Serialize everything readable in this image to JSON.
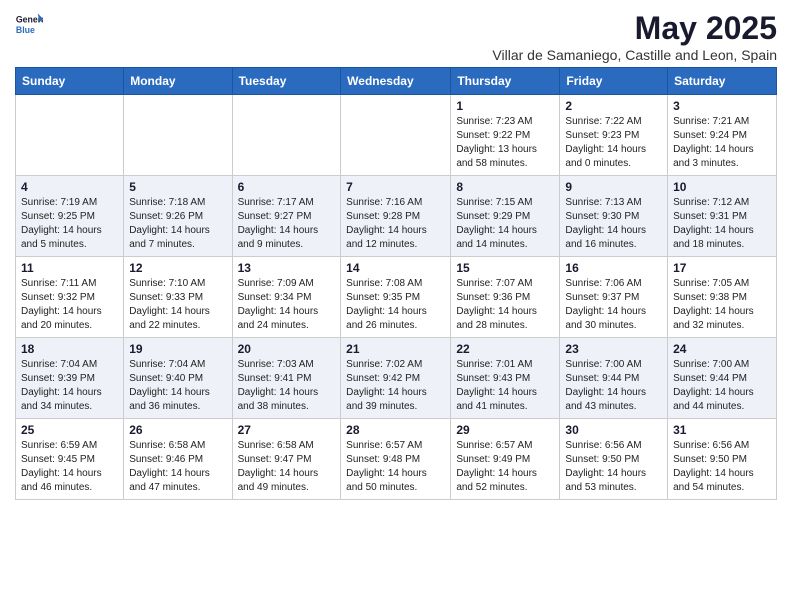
{
  "header": {
    "logo_general": "General",
    "logo_blue": "Blue",
    "title": "May 2025",
    "subtitle": "Villar de Samaniego, Castille and Leon, Spain"
  },
  "weekdays": [
    "Sunday",
    "Monday",
    "Tuesday",
    "Wednesday",
    "Thursday",
    "Friday",
    "Saturday"
  ],
  "weeks": [
    [
      {
        "day": "",
        "info": ""
      },
      {
        "day": "",
        "info": ""
      },
      {
        "day": "",
        "info": ""
      },
      {
        "day": "",
        "info": ""
      },
      {
        "day": "1",
        "info": "Sunrise: 7:23 AM\nSunset: 9:22 PM\nDaylight: 13 hours\nand 58 minutes."
      },
      {
        "day": "2",
        "info": "Sunrise: 7:22 AM\nSunset: 9:23 PM\nDaylight: 14 hours\nand 0 minutes."
      },
      {
        "day": "3",
        "info": "Sunrise: 7:21 AM\nSunset: 9:24 PM\nDaylight: 14 hours\nand 3 minutes."
      }
    ],
    [
      {
        "day": "4",
        "info": "Sunrise: 7:19 AM\nSunset: 9:25 PM\nDaylight: 14 hours\nand 5 minutes."
      },
      {
        "day": "5",
        "info": "Sunrise: 7:18 AM\nSunset: 9:26 PM\nDaylight: 14 hours\nand 7 minutes."
      },
      {
        "day": "6",
        "info": "Sunrise: 7:17 AM\nSunset: 9:27 PM\nDaylight: 14 hours\nand 9 minutes."
      },
      {
        "day": "7",
        "info": "Sunrise: 7:16 AM\nSunset: 9:28 PM\nDaylight: 14 hours\nand 12 minutes."
      },
      {
        "day": "8",
        "info": "Sunrise: 7:15 AM\nSunset: 9:29 PM\nDaylight: 14 hours\nand 14 minutes."
      },
      {
        "day": "9",
        "info": "Sunrise: 7:13 AM\nSunset: 9:30 PM\nDaylight: 14 hours\nand 16 minutes."
      },
      {
        "day": "10",
        "info": "Sunrise: 7:12 AM\nSunset: 9:31 PM\nDaylight: 14 hours\nand 18 minutes."
      }
    ],
    [
      {
        "day": "11",
        "info": "Sunrise: 7:11 AM\nSunset: 9:32 PM\nDaylight: 14 hours\nand 20 minutes."
      },
      {
        "day": "12",
        "info": "Sunrise: 7:10 AM\nSunset: 9:33 PM\nDaylight: 14 hours\nand 22 minutes."
      },
      {
        "day": "13",
        "info": "Sunrise: 7:09 AM\nSunset: 9:34 PM\nDaylight: 14 hours\nand 24 minutes."
      },
      {
        "day": "14",
        "info": "Sunrise: 7:08 AM\nSunset: 9:35 PM\nDaylight: 14 hours\nand 26 minutes."
      },
      {
        "day": "15",
        "info": "Sunrise: 7:07 AM\nSunset: 9:36 PM\nDaylight: 14 hours\nand 28 minutes."
      },
      {
        "day": "16",
        "info": "Sunrise: 7:06 AM\nSunset: 9:37 PM\nDaylight: 14 hours\nand 30 minutes."
      },
      {
        "day": "17",
        "info": "Sunrise: 7:05 AM\nSunset: 9:38 PM\nDaylight: 14 hours\nand 32 minutes."
      }
    ],
    [
      {
        "day": "18",
        "info": "Sunrise: 7:04 AM\nSunset: 9:39 PM\nDaylight: 14 hours\nand 34 minutes."
      },
      {
        "day": "19",
        "info": "Sunrise: 7:04 AM\nSunset: 9:40 PM\nDaylight: 14 hours\nand 36 minutes."
      },
      {
        "day": "20",
        "info": "Sunrise: 7:03 AM\nSunset: 9:41 PM\nDaylight: 14 hours\nand 38 minutes."
      },
      {
        "day": "21",
        "info": "Sunrise: 7:02 AM\nSunset: 9:42 PM\nDaylight: 14 hours\nand 39 minutes."
      },
      {
        "day": "22",
        "info": "Sunrise: 7:01 AM\nSunset: 9:43 PM\nDaylight: 14 hours\nand 41 minutes."
      },
      {
        "day": "23",
        "info": "Sunrise: 7:00 AM\nSunset: 9:44 PM\nDaylight: 14 hours\nand 43 minutes."
      },
      {
        "day": "24",
        "info": "Sunrise: 7:00 AM\nSunset: 9:44 PM\nDaylight: 14 hours\nand 44 minutes."
      }
    ],
    [
      {
        "day": "25",
        "info": "Sunrise: 6:59 AM\nSunset: 9:45 PM\nDaylight: 14 hours\nand 46 minutes."
      },
      {
        "day": "26",
        "info": "Sunrise: 6:58 AM\nSunset: 9:46 PM\nDaylight: 14 hours\nand 47 minutes."
      },
      {
        "day": "27",
        "info": "Sunrise: 6:58 AM\nSunset: 9:47 PM\nDaylight: 14 hours\nand 49 minutes."
      },
      {
        "day": "28",
        "info": "Sunrise: 6:57 AM\nSunset: 9:48 PM\nDaylight: 14 hours\nand 50 minutes."
      },
      {
        "day": "29",
        "info": "Sunrise: 6:57 AM\nSunset: 9:49 PM\nDaylight: 14 hours\nand 52 minutes."
      },
      {
        "day": "30",
        "info": "Sunrise: 6:56 AM\nSunset: 9:50 PM\nDaylight: 14 hours\nand 53 minutes."
      },
      {
        "day": "31",
        "info": "Sunrise: 6:56 AM\nSunset: 9:50 PM\nDaylight: 14 hours\nand 54 minutes."
      }
    ]
  ]
}
